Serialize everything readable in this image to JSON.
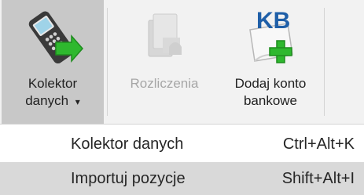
{
  "ribbon": {
    "buttons": [
      {
        "label_line1": "Kolektor",
        "label_line2": "danych",
        "dropdown_glyph": "▾",
        "icon": "barcode-scanner-icon",
        "state": "selected"
      },
      {
        "label_line1": "Rozliczenia",
        "label_line2": "",
        "icon": "settlement-icon",
        "state": "disabled"
      },
      {
        "label_line1": "Dodaj konto",
        "label_line2": "bankowe",
        "icon": "add-bank-account-icon",
        "icon_text": "KB",
        "state": "normal"
      }
    ]
  },
  "menu": {
    "items": [
      {
        "label": "Kolektor danych",
        "shortcut": "Ctrl+Alt+K"
      },
      {
        "label": "Importuj pozycje",
        "shortcut": "Shift+Alt+I",
        "highlighted": true
      }
    ]
  },
  "colors": {
    "ribbon_bg": "#f2f2f2",
    "selected_bg": "#c8c8c8",
    "menu_highlight": "#d9d9d9",
    "accent_green": "#2eb82e",
    "kb_blue": "#1f5fa8"
  }
}
